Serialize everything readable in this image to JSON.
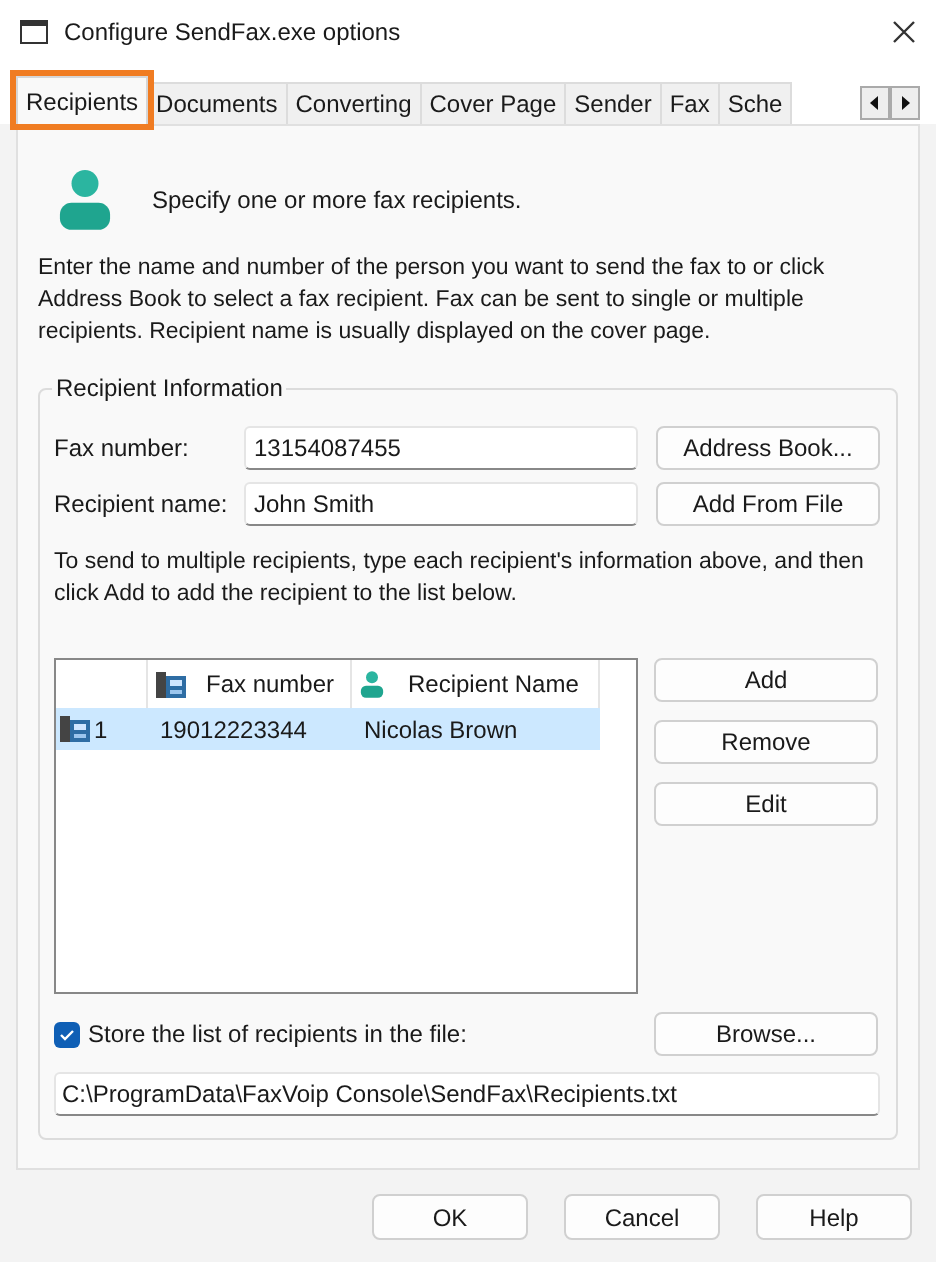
{
  "window": {
    "title": "Configure SendFax.exe options"
  },
  "tabs": [
    {
      "label": "Recipients",
      "selected": true,
      "highlighted": true
    },
    {
      "label": "Documents",
      "selected": false,
      "highlighted": false
    },
    {
      "label": "Converting",
      "selected": false,
      "highlighted": false
    },
    {
      "label": "Cover Page",
      "selected": false,
      "highlighted": false
    },
    {
      "label": "Sender",
      "selected": false,
      "highlighted": false
    },
    {
      "label": "Fax",
      "selected": false,
      "highlighted": false
    },
    {
      "label": "Sche",
      "selected": false,
      "highlighted": false
    }
  ],
  "header": "Specify one or more fax recipients.",
  "intro": "Enter the name and number of the person you want to send the fax to or click Address Book to select a fax recipient. Fax can be sent to single or multiple recipients. Recipient name is usually displayed on the cover page.",
  "group": {
    "title": "Recipient Information",
    "fields": [
      {
        "label": "Fax number:",
        "value": "13154087455",
        "button": "Address Book..."
      },
      {
        "label": "Recipient name:",
        "value": "John Smith",
        "button": "Add From File"
      }
    ],
    "hint": "To send to multiple recipients, type each recipient's information above, and then click Add to add the recipient to the list below.",
    "table": {
      "columns": [
        "Fax number",
        "Recipient Name"
      ],
      "rows": [
        {
          "index": "1",
          "fax": "19012223344",
          "name": "Nicolas Brown",
          "selected": true
        }
      ]
    },
    "list_buttons": [
      "Add",
      "Remove",
      "Edit"
    ],
    "store": {
      "label": "Store the list of recipients in the file:",
      "checked": true,
      "button": "Browse...",
      "path": "C:\\ProgramData\\FaxVoip Console\\SendFax\\Recipients.txt"
    }
  },
  "buttons": [
    "OK",
    "Cancel",
    "Help"
  ]
}
